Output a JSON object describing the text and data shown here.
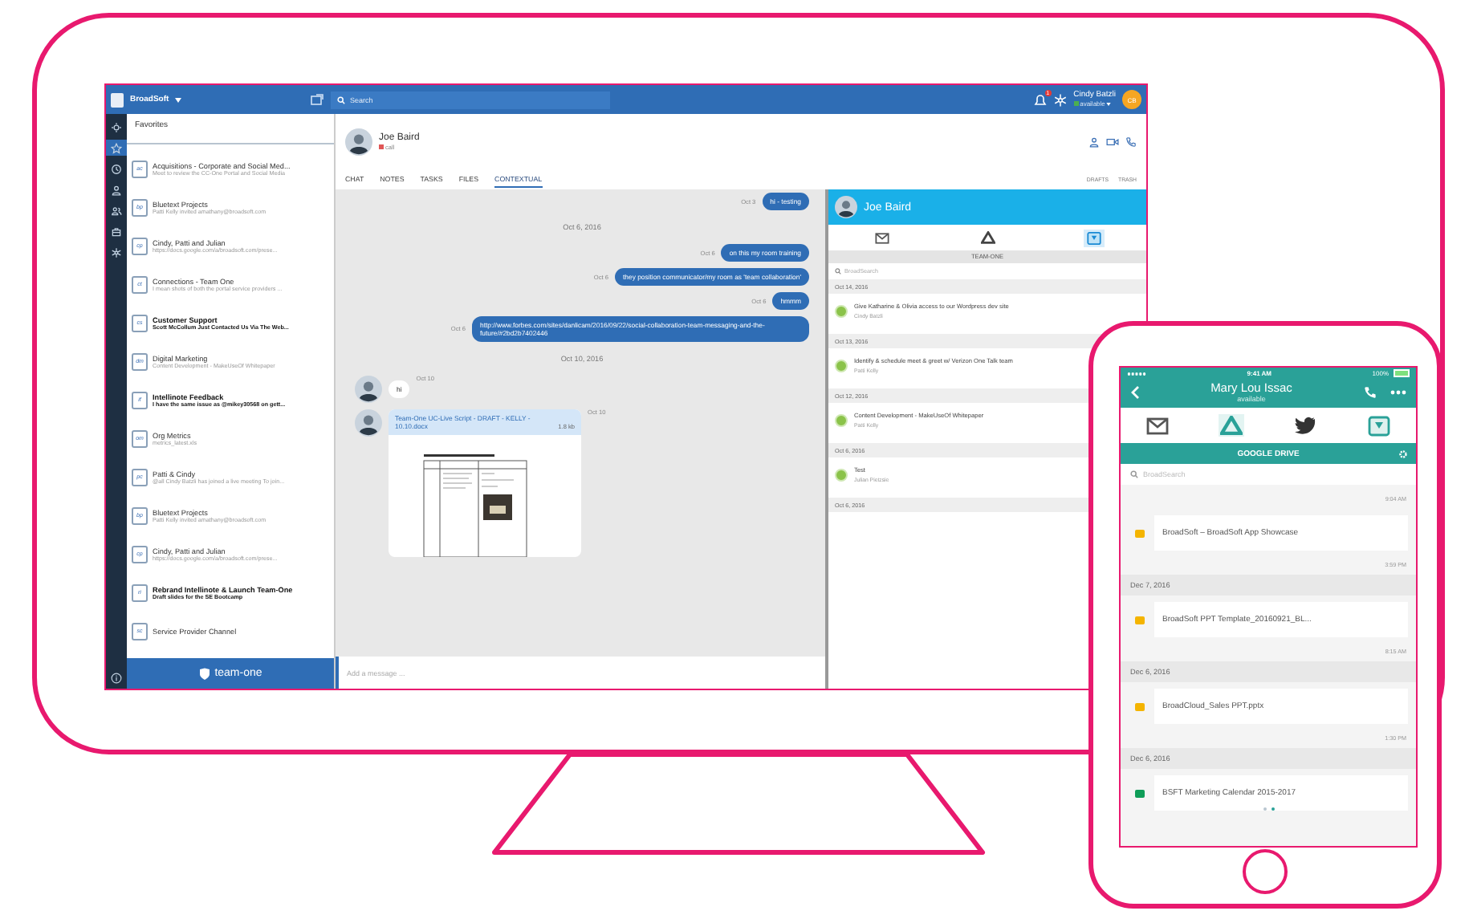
{
  "monitor": {
    "app_bar": {
      "workspace": "BroadSoft",
      "search_placeholder": "Search",
      "notification_count": "1",
      "user_name": "Cindy Batzli",
      "user_status": "available",
      "user_initials": "CB"
    },
    "rail": [
      {
        "kind": "gear",
        "selected": false
      },
      {
        "kind": "star",
        "selected": true
      },
      {
        "kind": "clock",
        "selected": false
      },
      {
        "kind": "person",
        "selected": false
      },
      {
        "kind": "people",
        "selected": false
      },
      {
        "kind": "briefcase",
        "selected": false
      },
      {
        "kind": "network",
        "selected": false
      }
    ],
    "favorites": {
      "title": "Favorites",
      "items": [
        {
          "initials": "ac",
          "title": "Acquisitions - Corporate and Social Med...",
          "preview": "Meet to review the CC-One Portal and Social Media",
          "unread": false
        },
        {
          "initials": "bp",
          "title": "Bluetext Projects",
          "preview": "Patti Kelly invited amathany@broadsoft.com",
          "unread": false
        },
        {
          "initials": "cp",
          "title": "Cindy, Patti and Julian",
          "preview": "https://docs.google.com/a/broadsoft.com/prese...",
          "unread": false
        },
        {
          "initials": "ct",
          "title": "Connections - Team One",
          "preview": "I mean shots of both the portal service providers ...",
          "unread": false
        },
        {
          "initials": "cs",
          "title": "Customer Support",
          "preview": "Scott McCollum Just Contacted Us Via The Web...",
          "unread": true
        },
        {
          "initials": "dm",
          "title": "Digital Marketing",
          "preview": "Content Development - MakeUseOf Whitepaper",
          "unread": false
        },
        {
          "initials": "if",
          "title": "Intellinote Feedback",
          "preview": "I have the same issue as @mikey30568 on gett...",
          "unread": true
        },
        {
          "initials": "om",
          "title": "Org Metrics",
          "preview": "metrics_latest.xls",
          "unread": false
        },
        {
          "initials": "pc",
          "title": "Patti & Cindy",
          "preview": "@all Cindy Batzli has joined a live meeting To join...",
          "unread": false
        },
        {
          "initials": "bp",
          "title": "Bluetext Projects",
          "preview": "Patti Kelly invited amathany@broadsoft.com",
          "unread": false
        },
        {
          "initials": "cp",
          "title": "Cindy, Patti and Julian",
          "preview": "https://docs.google.com/a/broadsoft.com/prese...",
          "unread": false
        },
        {
          "initials": "ri",
          "title": "Rebrand Intellinote & Launch Team-One",
          "preview": "Draft slides for the SE Bootcamp",
          "unread": true
        },
        {
          "initials": "sc",
          "title": "Service Provider Channel",
          "unread": false
        }
      ]
    },
    "brand": "team-one",
    "conversation": {
      "name": "Joe Baird",
      "status": "call",
      "tabs": [
        {
          "label": "CHAT",
          "selected": false
        },
        {
          "label": "NOTES",
          "selected": false
        },
        {
          "label": "TASKS",
          "selected": false
        },
        {
          "label": "FILES",
          "selected": false
        },
        {
          "label": "CONTEXTUAL",
          "selected": true
        }
      ],
      "links": [
        "DRAFTS",
        "TRASH"
      ],
      "messages": [
        {
          "kind": "out",
          "time": "Oct 3",
          "text": "hi - testing"
        },
        {
          "kind": "date",
          "text": "Oct 6, 2016"
        },
        {
          "kind": "out",
          "time": "Oct 6",
          "text": "on this my room training"
        },
        {
          "kind": "out",
          "time": "Oct 6",
          "text": "they position communicator/my room as 'team collaboration'"
        },
        {
          "kind": "out",
          "time": "Oct 6",
          "text": "hmmm"
        },
        {
          "kind": "out",
          "time": "Oct 6",
          "text": "http://www.forbes.com/sites/danlicam/2016/09/22/social-collaboration-team-messaging-and-the-future/#2bd2b7402446"
        },
        {
          "kind": "date",
          "text": "Oct 10, 2016"
        },
        {
          "kind": "in",
          "time": "Oct 10",
          "text": "hi"
        },
        {
          "kind": "file",
          "time": "Oct 10",
          "text": "Team-One UC-Live Script - DRAFT - KELLY - 10.10.docx",
          "size": "1.8 kb"
        }
      ],
      "input_placeholder": "Add a message ..."
    },
    "context_panel": {
      "name": "Joe Baird",
      "sources": [
        {
          "kind": "mail",
          "selected": false
        },
        {
          "kind": "drive",
          "selected": false
        },
        {
          "kind": "teamone",
          "selected": true
        }
      ],
      "source_title": "TEAM-ONE",
      "search_placeholder": "BroadSearch",
      "groups": [
        {
          "date": "Oct 14, 2016",
          "items": [
            {
              "title": "Give Katharine & Olivia access to our Wordpress dev site",
              "author": "Cindy Batzli"
            }
          ]
        },
        {
          "date": "Oct 13, 2016",
          "items": [
            {
              "title": "Identify & schedule meet & greet w/ Verizon One Talk team",
              "author": "Patti Kelly"
            }
          ]
        },
        {
          "date": "Oct 12, 2016",
          "items": [
            {
              "title": "Content Development - MakeUseOf Whitepaper",
              "author": "Patti Kelly"
            }
          ]
        },
        {
          "date": "Oct 6, 2016",
          "items": [
            {
              "title": "Test",
              "author": "Julian Pietzsie"
            }
          ]
        },
        {
          "date": "Oct 6, 2016"
        }
      ]
    }
  },
  "phone": {
    "status_bar": {
      "time": "9:41 AM",
      "battery": "100%"
    },
    "contact": {
      "name": "Mary Lou Issac",
      "status": "available"
    },
    "sources": [
      {
        "kind": "mail",
        "selected": false
      },
      {
        "kind": "drive",
        "selected": true
      },
      {
        "kind": "bird",
        "selected": false
      },
      {
        "kind": "teamone",
        "selected": false
      }
    ],
    "source_title": "GOOGLE DRIVE",
    "search_placeholder": "BroadSearch",
    "feed": [
      {
        "kind": "time",
        "text": "9:04 AM"
      },
      {
        "kind": "file",
        "color": "#f4b400",
        "text": "BroadSoft – BroadSoft App Showcase"
      },
      {
        "kind": "time",
        "text": "3:59 PM"
      },
      {
        "kind": "date",
        "text": "Dec 7, 2016"
      },
      {
        "kind": "file",
        "color": "#f4b400",
        "text": "BroadSoft PPT Template_20160921_BL..."
      },
      {
        "kind": "time",
        "text": "8:15 AM"
      },
      {
        "kind": "date",
        "text": "Dec 6, 2016"
      },
      {
        "kind": "file",
        "color": "#f4b400",
        "text": "BroadCloud_Sales PPT.pptx"
      },
      {
        "kind": "time",
        "text": "1:30 PM"
      },
      {
        "kind": "date",
        "text": "Dec 6, 2016"
      },
      {
        "kind": "file",
        "color": "#0f9d58",
        "text": "BSFT Marketing Calendar 2015-2017"
      }
    ],
    "pages": [
      {
        "selected": false
      },
      {
        "selected": true
      }
    ]
  }
}
